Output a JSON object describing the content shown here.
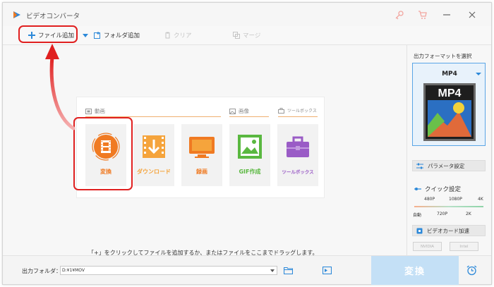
{
  "app": {
    "title": "ビデオコンバータ",
    "icons": [
      "app-logo-icon",
      "key-icon",
      "cart-icon",
      "minimize-icon",
      "close-icon"
    ]
  },
  "toolbar": {
    "add_file": "ファイル追加",
    "add_folder": "フォルダ追加",
    "clear": "クリア",
    "merge": "マージ"
  },
  "panel": {
    "sections": {
      "video": "動画",
      "image": "画像",
      "toolbox": "ツールボックス"
    },
    "tiles": [
      {
        "label": "変換",
        "icon": "film-reel-icon",
        "color": "#f07a22"
      },
      {
        "label": "ダウンロード",
        "icon": "download-icon",
        "color": "#f5a43c"
      },
      {
        "label": "録画",
        "icon": "monitor-icon",
        "color": "#f07a22"
      },
      {
        "label": "GIF作成",
        "icon": "gif-image-icon",
        "color": "#5ab840"
      },
      {
        "label": "ツールボックス",
        "icon": "toolbox-icon",
        "color": "#9a5cc6"
      }
    ]
  },
  "hint": "「+」をクリックしてファイルを追加するか、またはファイルをここまでドラッグします。",
  "sidebar": {
    "output_format_title": "出力フォーマットを選択",
    "selected_format": "MP4",
    "format_badge": "MP4",
    "param_settings": "パラメータ設定",
    "quick_settings": "クイック設定",
    "quality_top": [
      "480P",
      "1080P",
      "4K"
    ],
    "quality_bottom": [
      "自動",
      "720P",
      "2K"
    ],
    "gpu_accel": "ビデオカード加速",
    "gpu_nvidia": "NVIDIA",
    "gpu_intel": "Intel"
  },
  "bottom": {
    "output_folder_label": "出力フォルダ：",
    "output_folder_value": "D:¥1¥MOV",
    "convert_label": "変換"
  },
  "colors": {
    "accent_blue": "#2c89d9",
    "orange": "#f07a22",
    "annotation_red": "#e02020",
    "convert_disabled": "#c4e0f6"
  }
}
